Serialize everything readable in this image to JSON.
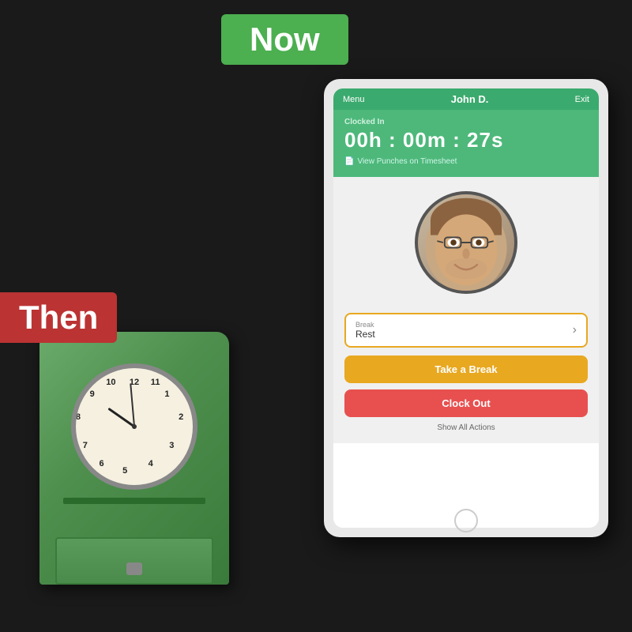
{
  "background": {
    "color": "#1a1a1a"
  },
  "now_label": {
    "text": "Now",
    "bg_color": "#4caf50",
    "text_color": "#ffffff"
  },
  "then_label": {
    "text": "Then",
    "bg_color": "#b33333",
    "text_color": "#ffffff"
  },
  "tablet": {
    "topbar": {
      "menu": "Menu",
      "name": "John D.",
      "exit": "Exit",
      "bg_color": "#3baa6e"
    },
    "clocked": {
      "label": "Clocked In",
      "time": "00h : 00m : 27s",
      "bg_color": "#4db87a",
      "view_punches": "View Punches on Timesheet"
    },
    "break_row": {
      "label_small": "Break",
      "label_main": "Rest"
    },
    "buttons": {
      "take_break": "Take a Break",
      "clock_out": "Clock Out",
      "show_all": "Show All Actions"
    }
  },
  "old_clock": {
    "label": "vintage time clock",
    "color": "#5a9a5a"
  }
}
